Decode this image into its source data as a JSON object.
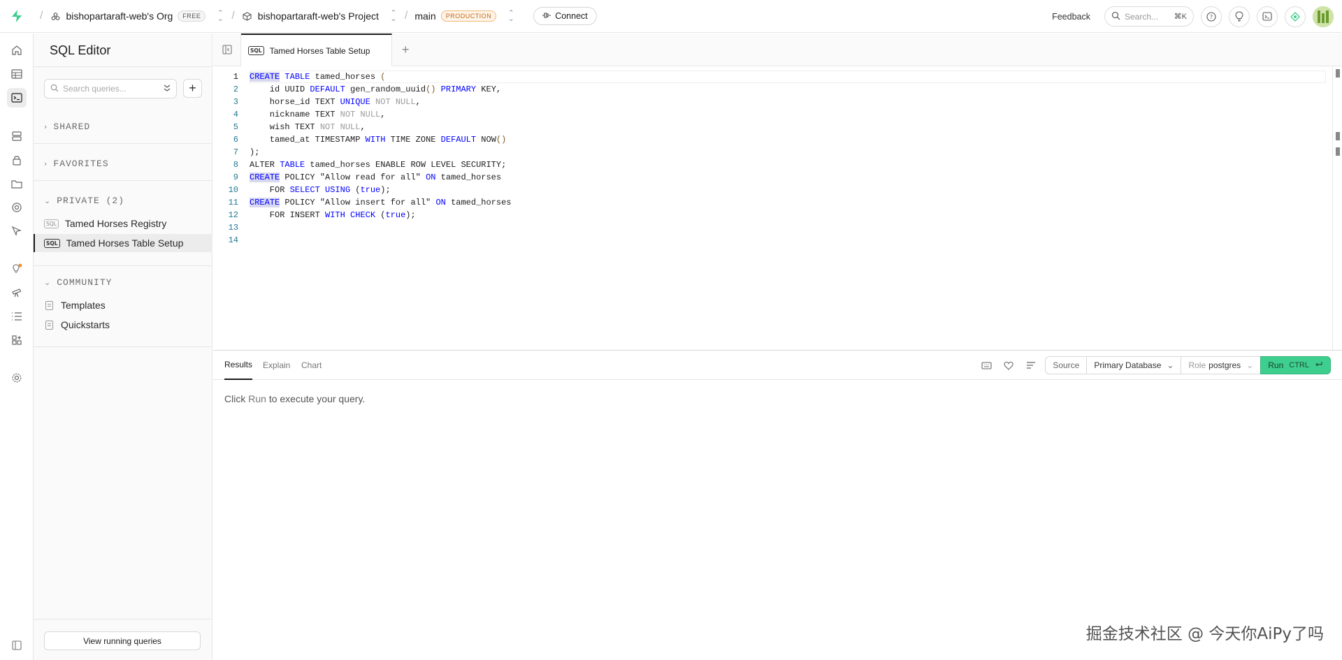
{
  "topbar": {
    "org_name": "bishopartaraft-web's Org",
    "org_badge": "FREE",
    "project_name": "bishopartaraft-web's Project",
    "branch_name": "main",
    "branch_badge": "PRODUCTION",
    "connect_label": "Connect",
    "feedback_label": "Feedback",
    "search_placeholder": "Search...",
    "search_shortcut": "⌘K"
  },
  "sidebar": {
    "title": "SQL Editor",
    "search_placeholder": "Search queries...",
    "sections": {
      "shared": "SHARED",
      "favorites": "FAVORITES",
      "private": "PRIVATE (2)",
      "community": "COMMUNITY"
    },
    "private_items": [
      {
        "label": "Tamed Horses Registry",
        "tag": "SQL"
      },
      {
        "label": "Tamed Horses Table Setup",
        "tag": "SQL"
      }
    ],
    "community_items": [
      {
        "label": "Templates"
      },
      {
        "label": "Quickstarts"
      }
    ],
    "view_running_label": "View running queries"
  },
  "tabs": [
    {
      "label": "Tamed Horses Table Setup",
      "tag": "SQL"
    }
  ],
  "editor": {
    "line_numbers": [
      "1",
      "2",
      "3",
      "4",
      "5",
      "6",
      "7",
      "8",
      "9",
      "10",
      "11",
      "12",
      "13",
      "14"
    ]
  },
  "results": {
    "tabs": [
      "Results",
      "Explain",
      "Chart"
    ],
    "source_label": "Source",
    "database_label": "Primary Database",
    "role_prefix": "Role",
    "role_value": "postgres",
    "run_label": "Run",
    "run_shortcut": "CTRL",
    "empty_prefix": "Click",
    "empty_run": "Run",
    "empty_suffix": "to execute your query."
  },
  "watermark": "掘金技术社区 @ 今天你AiPy了吗",
  "colors": {
    "brand": "#3ecf8e",
    "keyword": "#0000ff",
    "badge_prod": "#c2691b"
  }
}
